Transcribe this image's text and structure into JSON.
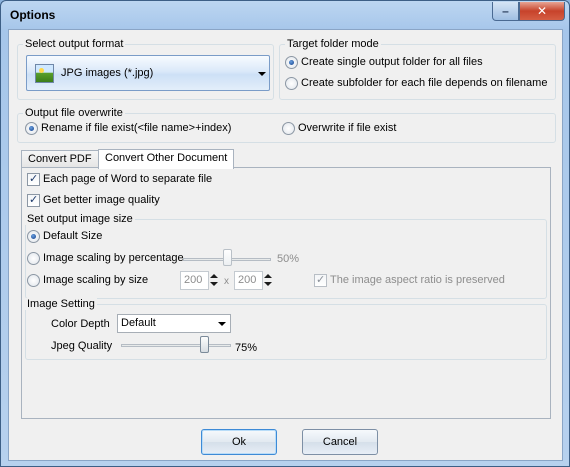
{
  "window": {
    "title": "Options",
    "minimize_icon": "minimize-icon",
    "close_icon": "close-icon",
    "minimize_glyph": "–",
    "close_glyph": "✕"
  },
  "output_format": {
    "group_label": "Select output format",
    "selected": "JPG images (*.jpg)",
    "icon": "image-file-icon"
  },
  "target_folder": {
    "group_label": "Target folder mode",
    "options": [
      {
        "label": "Create single output folder for all files",
        "selected": true
      },
      {
        "label": "Create subfolder for each file depends on filename",
        "selected": false
      }
    ]
  },
  "overwrite": {
    "group_label": "Output file overwrite",
    "options": [
      {
        "label": "Rename if file exist(<file name>+index)",
        "selected": true
      },
      {
        "label": "Overwrite if file exist",
        "selected": false
      }
    ]
  },
  "tabs": [
    {
      "label": "Convert PDF",
      "active": false
    },
    {
      "label": "Convert Other Document",
      "active": true
    }
  ],
  "convert_other": {
    "each_page_separate": {
      "label": "Each page of Word to separate file",
      "checked": true
    },
    "better_quality": {
      "label": "Get better image quality",
      "checked": true
    },
    "image_size": {
      "group_label": "Set output image size",
      "default_size": {
        "label": "Default Size",
        "selected": true
      },
      "scaling_percentage": {
        "label": "Image scaling by percentage",
        "selected": false,
        "value_text": "50%",
        "level": 0.5
      },
      "scaling_size": {
        "label": "Image scaling by size",
        "selected": false,
        "width": "200",
        "height": "200",
        "separator": "x"
      },
      "aspect_ratio": {
        "label": "The image aspect ratio is preserved",
        "checked": true,
        "enabled": false
      }
    },
    "image_setting": {
      "group_label": "Image Setting",
      "color_depth": {
        "label": "Color Depth",
        "value": "Default"
      },
      "jpeg_quality": {
        "label": "Jpeg Quality",
        "value_text": "75%",
        "level": 0.75
      }
    }
  },
  "buttons": {
    "ok": "Ok",
    "cancel": "Cancel"
  },
  "colors": {
    "title_bar": "#a9c8eb",
    "close_button": "#c7432b",
    "dialog_bg": "#f0f0f0"
  }
}
